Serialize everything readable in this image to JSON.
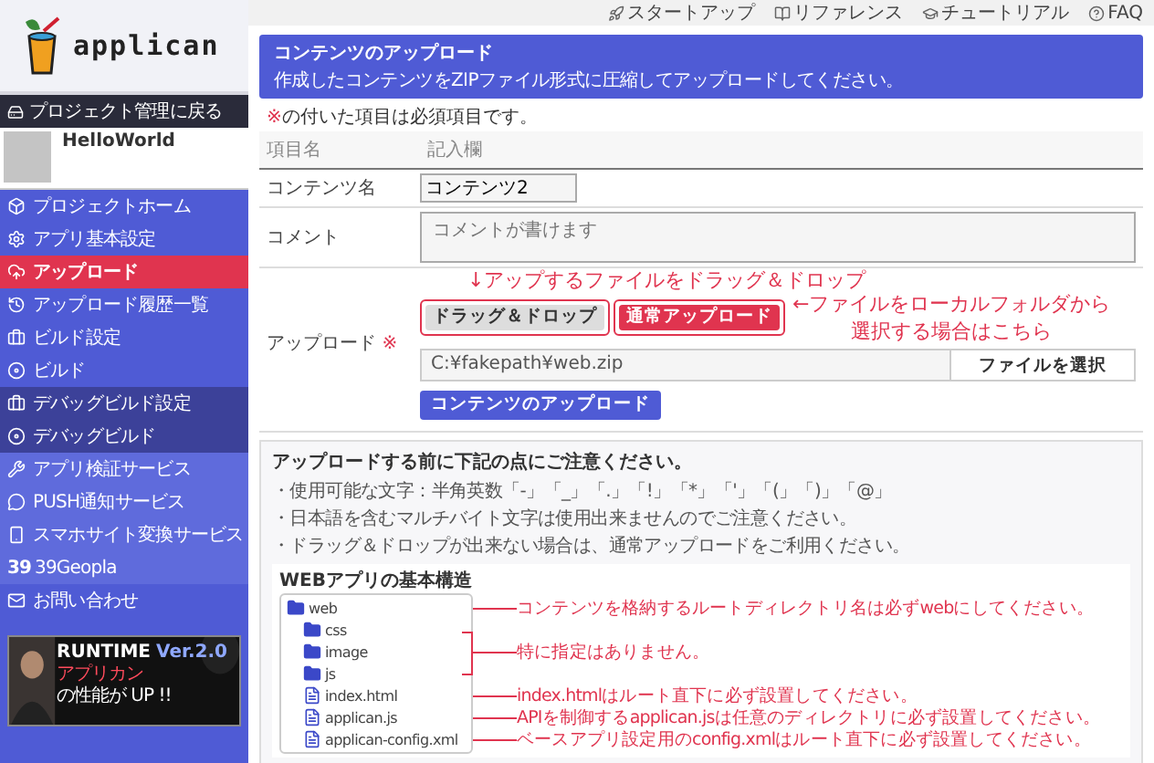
{
  "sidebar": {
    "logo": "applican",
    "back_button": "プロジェクト管理に戻る",
    "project": {
      "name": "HelloWorld"
    },
    "items": [
      {
        "label": "プロジェクトホーム",
        "kind": "home",
        "color": "#4f5bd5",
        "selected": false
      },
      {
        "label": "アプリ基本設定",
        "kind": "settings",
        "color": "#4f5bd5",
        "selected": false
      },
      {
        "label": "アップロード",
        "kind": "upload",
        "selected": true
      },
      {
        "label": "アップロード履歴一覧",
        "kind": "history",
        "color": "#4f5bd5",
        "selected": false
      },
      {
        "label": "ビルド設定",
        "kind": "briefcase",
        "color": "#4f5bd5",
        "selected": false
      },
      {
        "label": "ビルド",
        "kind": "build",
        "color": "#4f5bd5",
        "selected": false
      },
      {
        "label": "デバッグビルド設定",
        "kind": "briefcase",
        "color": "#3c4199",
        "selected": false
      },
      {
        "label": "デバッグビルド",
        "kind": "build",
        "color": "#3c4199",
        "selected": false
      },
      {
        "label": "アプリ検証サービス",
        "kind": "wrench",
        "color": "#5f6bdc",
        "selected": false
      },
      {
        "label": "PUSH通知サービス",
        "kind": "chat",
        "color": "#5f6bdc",
        "selected": false
      },
      {
        "label": "スマホサイト変換サービス",
        "kind": "phone",
        "color": "#5f6bdc",
        "selected": false
      },
      {
        "label": "39Geopla",
        "kind": "text",
        "icon_text": "39",
        "color": "#5f6bdc",
        "selected": false
      },
      {
        "label": "お問い合わせ",
        "kind": "mail",
        "color": "#4f5bd5",
        "selected": false
      }
    ],
    "banner": {
      "kind": "picture",
      "title": "RUNTIME",
      "version": "Ver.2.0",
      "highlight": "アプリカン",
      "subtitle": "の性能が UP !!"
    }
  },
  "top_links": [
    {
      "label": "スタートアップ",
      "kind": "rocket"
    },
    {
      "label": "リファレンス",
      "kind": "book"
    },
    {
      "label": "チュートリアル",
      "kind": "cap"
    },
    {
      "label": "FAQ",
      "kind": "help"
    }
  ],
  "header": {
    "title": "コンテンツのアップロード",
    "description": "作成したコンテンツをZIPファイル形式に圧縮してアップロードしてください。"
  },
  "required_note": {
    "mark": "※",
    "text": "の付いた項目は必須項目です。"
  },
  "form": {
    "columns": [
      "項目名",
      "記入欄"
    ],
    "content_name": {
      "label": "コンテンツ名",
      "value": "コンテンツ2"
    },
    "comment": {
      "label": "コメント",
      "placeholder": "コメントが書けます"
    },
    "upload": {
      "label": "アップロード",
      "required_mark": "※",
      "modes": [
        {
          "label": "ドラッグ＆ドロップ",
          "selected": false
        },
        {
          "label": "通常アップロード",
          "selected": true
        }
      ],
      "file_path": "C:¥fakepath¥web.zip",
      "choose_button": "ファイルを選択",
      "submit": "コンテンツのアップロード",
      "annotation_drag": "↓アップするファイルをドラッグ＆ドロップ",
      "annotation_select": [
        "←ファイルをローカルフォルダから",
        "選択する場合はこちら"
      ]
    }
  },
  "notes": {
    "title": "アップロードする前に下記の点にご注意ください。",
    "lines": [
      "・使用可能な文字：半角英数「-」「_」「.」「!」「*」「'」「(」「)」「@」",
      "・日本語を含むマルチバイト文字は使用出来ませんのでご注意ください。",
      "・ドラッグ＆ドロップが出来ない場合は、通常アップロードをご利用ください。"
    ],
    "structure": {
      "title": "WEBアプリの基本構造",
      "tree": [
        {
          "name": "web",
          "kind": "folder",
          "note": "コンテンツを格納するルートディレクトリ名は必ずwebにしてください。",
          "children": [
            {
              "kind": "group",
              "note": "特に指定はありません。",
              "children": [
                {
                  "name": "css",
                  "kind": "folder"
                },
                {
                  "name": "image",
                  "kind": "folder"
                },
                {
                  "name": "js",
                  "kind": "folder"
                }
              ]
            },
            {
              "name": "index.html",
              "kind": "file",
              "note": "index.htmlはルート直下に必ず設置してください。"
            },
            {
              "name": "applican.js",
              "kind": "file",
              "note": "APIを制御するapplican.jsは任意のディレクトリに必ず設置してください。"
            },
            {
              "name": "applican-config.xml",
              "kind": "file",
              "note": "ベースアプリ設定用のconfig.xmlはルート直下に必ず設置してください。"
            }
          ]
        }
      ]
    }
  }
}
